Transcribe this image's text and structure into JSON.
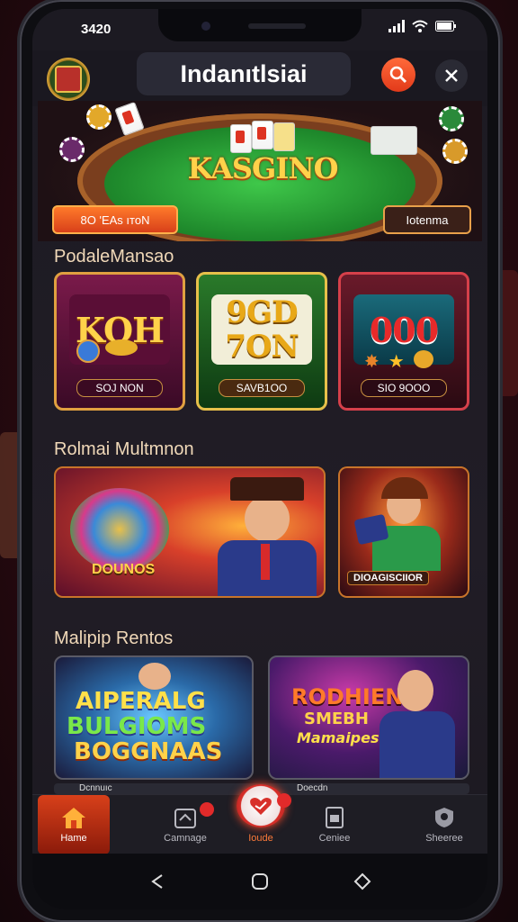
{
  "status": {
    "time": "3420"
  },
  "header": {
    "title": "Indanıtlsiai"
  },
  "hero": {
    "title": "KASGINO",
    "left_button": "8O 'EAs ıтоN",
    "right_button": "Iotenma"
  },
  "sections": {
    "slots_title": "PodaleMansao",
    "promos_title": "Rolmai Multmnon",
    "featured_title": "Malipip Rentos"
  },
  "slots": [
    {
      "big": "KOH",
      "pill": "SOJ NON"
    },
    {
      "big_line1": "9GD",
      "big_line2": "7ON",
      "pill": "SAVB1OO"
    },
    {
      "big": "000",
      "pill": "SIO 9OOO"
    }
  ],
  "promos": [
    {
      "label": "DOUNOS"
    },
    {
      "label": "DIOAGISCIIOR"
    }
  ],
  "featured": [
    {
      "line1": "AIPERALG",
      "line2": "BULGIOMS",
      "line3": "BOGGNAAS"
    },
    {
      "line1": "RODHIEN",
      "line2": "SMEBH",
      "line3": "Mamaipes"
    }
  ],
  "peek": {
    "left": "Dcnnuıc",
    "right": "Doecdn"
  },
  "nav": {
    "home": "Hame",
    "games": "Camnage",
    "center": "Ioude",
    "center_badge": "",
    "games_badge": "",
    "carries": "Ceniee",
    "shoes": "Sheeree"
  },
  "colors": {
    "accent": "#e23a1a",
    "gold": "#ffd24a",
    "felt": "#1f8a2c"
  }
}
